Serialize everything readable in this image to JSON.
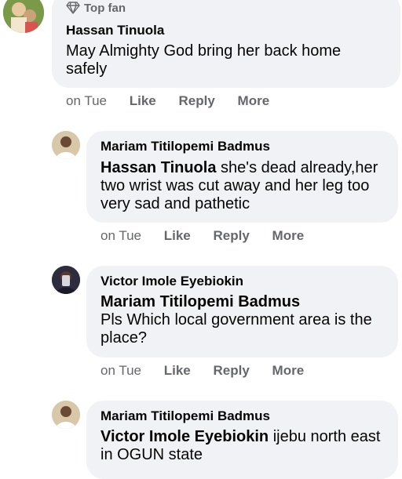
{
  "comments": [
    {
      "badge": "Top fan",
      "badge_icon": "diamond-icon",
      "author": "Hassan Tinuola",
      "mention": "",
      "text": "May Almighty God bring her back home safely",
      "time": "on Tue",
      "like": "Like",
      "reply": "Reply",
      "more": "More"
    },
    {
      "author": "Mariam Titilopemi Badmus",
      "mention": "Hassan Tinuola",
      "text": " she's dead already,her two wrist was cut away and her leg too very sad and pathetic",
      "time": "on Tue",
      "like": "Like",
      "reply": "Reply",
      "more": "More"
    },
    {
      "author": "Victor Imole Eyebiokin",
      "mention": "Mariam Titilopemi Badmus",
      "text": "Pls Which local government area is the place?",
      "time": "on Tue",
      "like": "Like",
      "reply": "Reply",
      "more": "More"
    },
    {
      "author": "Mariam Titilopemi Badmus",
      "mention": "Victor Imole Eyebiokin",
      "text": " ijebu north east in OGUN state"
    }
  ],
  "colors": {
    "bubble": "#f0f2f5",
    "text": "#050505",
    "muted": "#65676b"
  }
}
